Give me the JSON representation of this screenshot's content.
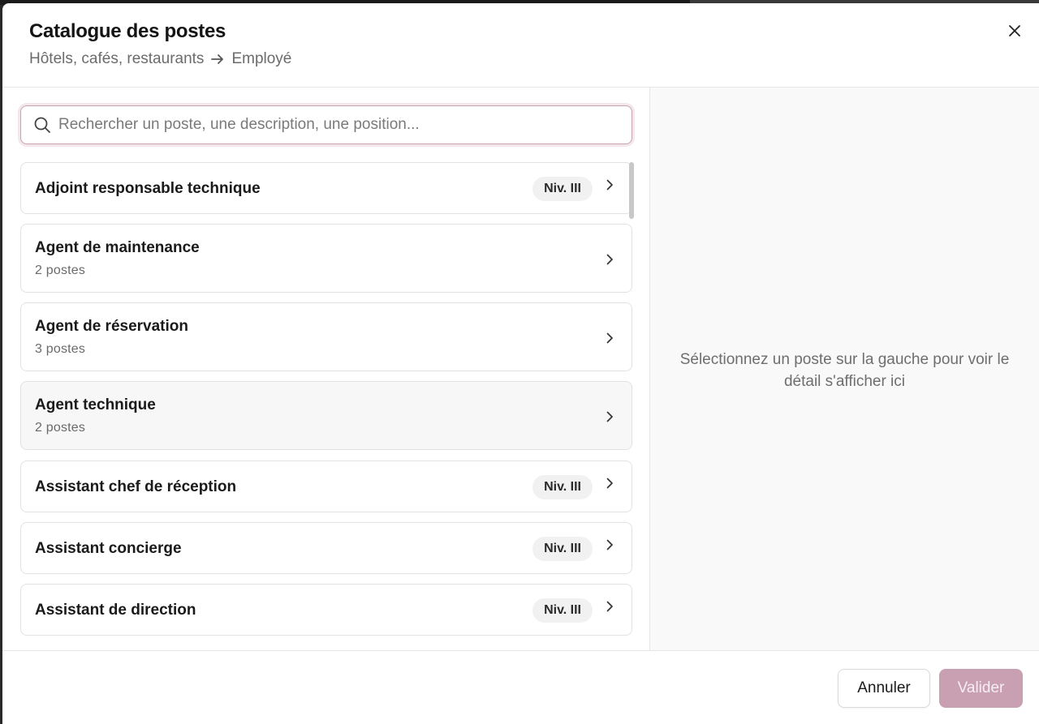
{
  "dialog": {
    "title": "Catalogue des postes",
    "breadcrumb": {
      "from": "Hôtels, cafés, restaurants",
      "to": "Employé"
    }
  },
  "search": {
    "placeholder": "Rechercher un poste, une description, une position...",
    "value": ""
  },
  "positions": [
    {
      "title": "Adjoint responsable technique",
      "subtitle": "",
      "badge": "Niv. III"
    },
    {
      "title": "Agent de maintenance",
      "subtitle": "2 postes",
      "badge": ""
    },
    {
      "title": "Agent de réservation",
      "subtitle": "3 postes",
      "badge": ""
    },
    {
      "title": "Agent technique",
      "subtitle": "2 postes",
      "badge": ""
    },
    {
      "title": "Assistant chef de réception",
      "subtitle": "",
      "badge": "Niv. III"
    },
    {
      "title": "Assistant concierge",
      "subtitle": "",
      "badge": "Niv. III"
    },
    {
      "title": "Assistant de direction",
      "subtitle": "",
      "badge": "Niv. III"
    }
  ],
  "detail": {
    "empty_message": "Sélectionnez un poste sur la gauche pour voir le détail s'afficher ici"
  },
  "footer": {
    "cancel_label": "Annuler",
    "validate_label": "Valider"
  },
  "colors": {
    "accent": "#c9a0b1",
    "focus_border": "#c9a3b3"
  }
}
